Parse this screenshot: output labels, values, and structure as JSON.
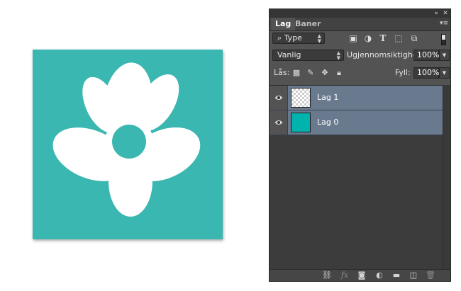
{
  "canvas": {
    "background_color": "#3ab7b0",
    "flower_color": "#ffffff"
  },
  "panel": {
    "titlebar": {
      "collapse_icon": "double-chevron-left-icon",
      "close_icon": "close-icon"
    },
    "tabs": [
      {
        "label": "Lag",
        "active": true
      },
      {
        "label": "Baner",
        "active": false
      }
    ],
    "filter": {
      "kind_icon": "search-icon",
      "kind_label": "Type",
      "icons": [
        "image-filter-icon",
        "adjustment-filter-icon",
        "type-filter-icon",
        "shape-filter-icon",
        "smart-object-filter-icon"
      ]
    },
    "blend": {
      "mode": "Vanlig",
      "opacity_label": "Ugjennomsiktighet:",
      "opacity_value": "100%"
    },
    "lock": {
      "label": "Lås:",
      "icons": [
        "lock-transparent-pixels-icon",
        "lock-image-pixels-icon",
        "lock-position-icon",
        "lock-all-icon"
      ],
      "fill_label": "Fyll:",
      "fill_value": "100%"
    },
    "layers": [
      {
        "name": "Lag 1",
        "thumbnail": "transparent",
        "visible": true,
        "selected": true
      },
      {
        "name": "Lag 0",
        "thumbnail": "fill",
        "thumbnail_color": "#00b3ad",
        "visible": true,
        "selected": true
      }
    ],
    "bottom_icons": [
      "link-layers-icon",
      "fx-icon",
      "add-mask-icon",
      "adjustment-layer-icon",
      "new-group-icon",
      "new-layer-icon",
      "trash-icon"
    ]
  }
}
